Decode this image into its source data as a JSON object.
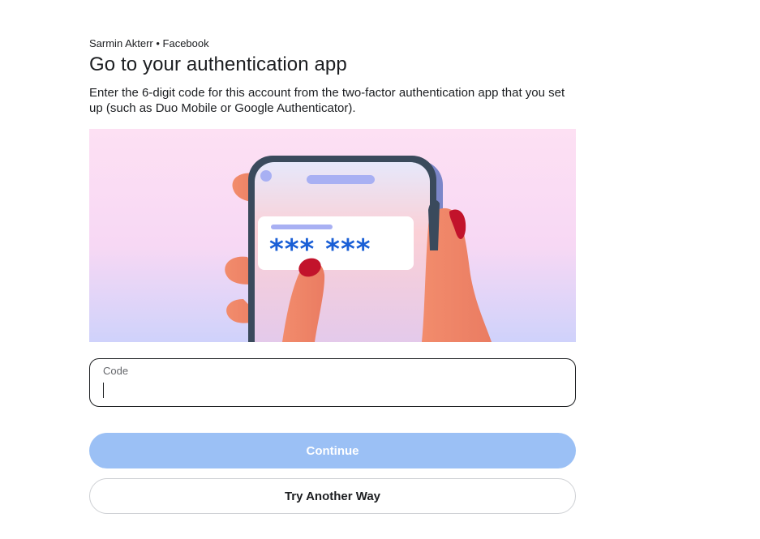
{
  "header": {
    "account_line": "Sarmin Akterr • Facebook",
    "title": "Go to your authentication app",
    "description": "Enter the 6-digit code for this account from the two-factor authentication app that you set up (such as Duo Mobile or Google Authenticator)."
  },
  "illustration": {
    "masked_code": "*** ***",
    "colors": {
      "background_top": "#fde0f3",
      "background_bottom": "#cfd2fb",
      "phone_frame": "#3a4a5c",
      "code_text": "#1a5fd6",
      "skin": "#f0876a",
      "nail": "#c2132b"
    }
  },
  "code_field": {
    "label": "Code",
    "value": ""
  },
  "buttons": {
    "continue_label": "Continue",
    "try_another_label": "Try Another Way"
  },
  "colors": {
    "continue_bg": "#9bc0f5",
    "text": "#1c1e21"
  }
}
